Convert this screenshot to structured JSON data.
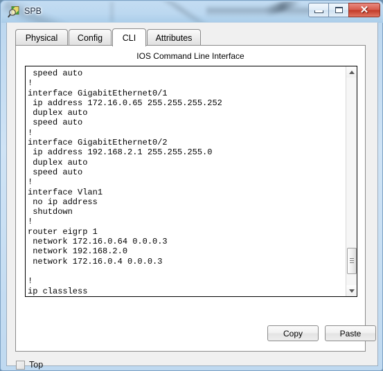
{
  "window": {
    "title": "SPB",
    "icon": "magnifier-document-icon",
    "controls": {
      "minimize": "minimize-icon",
      "maximize": "maximize-icon",
      "close": "✕"
    }
  },
  "tabs": [
    {
      "label": "Physical",
      "active": false
    },
    {
      "label": "Config",
      "active": false
    },
    {
      "label": "CLI",
      "active": true
    },
    {
      "label": "Attributes",
      "active": false
    }
  ],
  "cli": {
    "caption": "IOS Command Line Interface",
    "text": " speed auto\n!\ninterface GigabitEthernet0/1\n ip address 172.16.0.65 255.255.255.252\n duplex auto\n speed auto\n!\ninterface GigabitEthernet0/2\n ip address 192.168.2.1 255.255.255.0\n duplex auto\n speed auto\n!\ninterface Vlan1\n no ip address\n shutdown\n!\nrouter eigrp 1\n network 172.16.0.64 0.0.0.3\n network 192.168.2.0\n network 172.16.0.4 0.0.0.3\n\n!\nip classless\n!",
    "scrollbar": {
      "up_arrow": "scroll-up-icon",
      "down_arrow": "scroll-down-icon",
      "thumb_position_pct": 82
    }
  },
  "buttons": {
    "copy": "Copy",
    "paste": "Paste"
  },
  "footer": {
    "top_checkbox_label": "Top",
    "top_checkbox_checked": false
  },
  "colors": {
    "glass": "#bcd8f0",
    "close_button": "#c23a28",
    "client_bg": "#f0f0f0",
    "console_bg": "#ffffff",
    "text": "#000000"
  }
}
